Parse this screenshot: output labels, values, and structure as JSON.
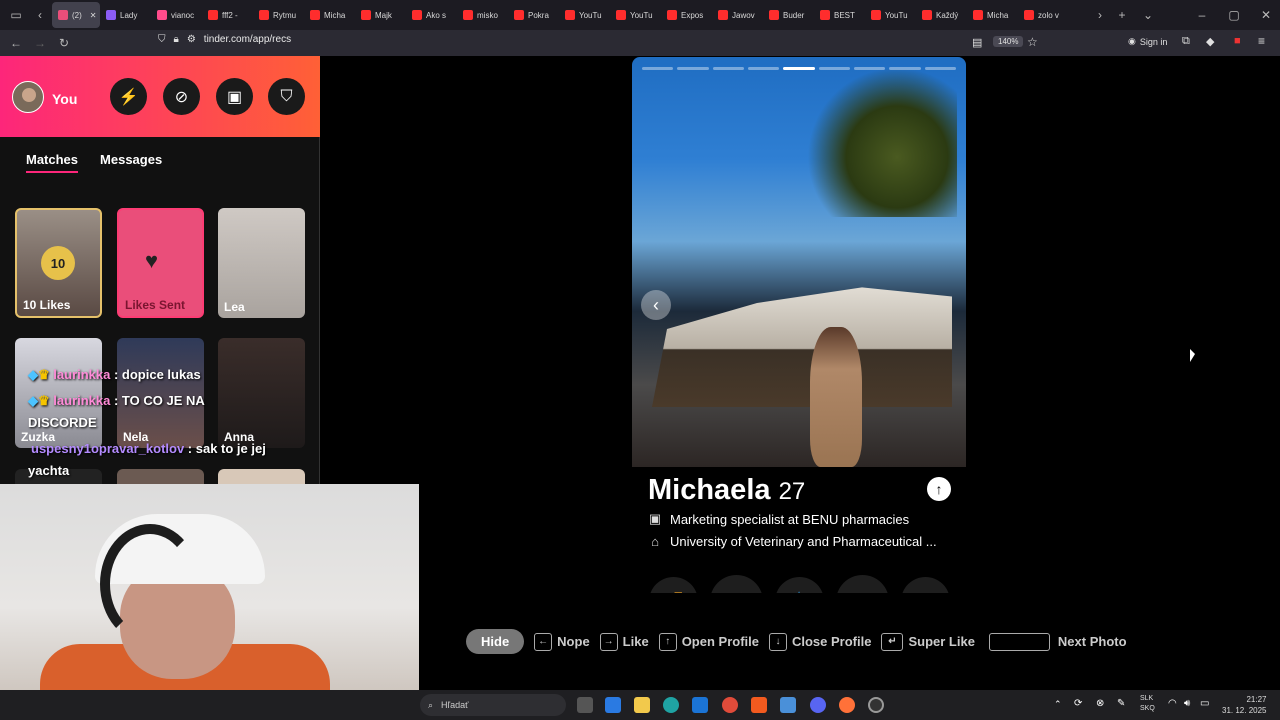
{
  "browser": {
    "tabs": [
      {
        "label": "(2)",
        "color": "#ea4e7a"
      },
      {
        "label": "Lady",
        "color": "#8b5cf6"
      },
      {
        "label": "vianoc",
        "color": "#ff4b8b"
      },
      {
        "label": "fff2 -",
        "color": "#ff2d2d"
      },
      {
        "label": "Rytmu",
        "color": "#ff2d2d"
      },
      {
        "label": "Micha",
        "color": "#ff2d2d"
      },
      {
        "label": "Majk",
        "color": "#ff2d2d"
      },
      {
        "label": "Ako s",
        "color": "#ff2d2d"
      },
      {
        "label": "misko",
        "color": "#ff2d2d"
      },
      {
        "label": "Pokra",
        "color": "#ff2d2d"
      },
      {
        "label": "YouTu",
        "color": "#ff2d2d"
      },
      {
        "label": "YouTu",
        "color": "#ff2d2d"
      },
      {
        "label": "Expos",
        "color": "#ff2d2d"
      },
      {
        "label": "Jawov",
        "color": "#ff2d2d"
      },
      {
        "label": "Buder",
        "color": "#ff2d2d"
      },
      {
        "label": "BEST",
        "color": "#ff2d2d"
      },
      {
        "label": "YouTu",
        "color": "#ff2d2d"
      },
      {
        "label": "Každý",
        "color": "#ff2d2d"
      },
      {
        "label": "Micha",
        "color": "#ff2d2d"
      },
      {
        "label": "zolo v",
        "color": "#ff2d2d"
      }
    ],
    "url": "tinder.com/app/recs",
    "zoom": "140%",
    "signin": "Sign in"
  },
  "left": {
    "you": "You",
    "tabs": {
      "matches": "Matches",
      "messages": "Messages"
    },
    "likes_count": "10",
    "likes_label": "10 Likes",
    "likes_sent": "Likes Sent",
    "cards": {
      "lea": "Lea",
      "zuzka": "Zuzka",
      "nela": "Nela",
      "anna": "Anna"
    }
  },
  "overlay": {
    "chat1_user": "laurinkka",
    "chat1_text": " : dopice lukas",
    "chat2_user": "laurinkka",
    "chat2_text": " : TO CO JE NA",
    "discorde": "DISCORDE",
    "chat3_user": "uspesny1opravar_kotlov",
    "chat3_text": " : sak to je jej",
    "yachta": "yachta"
  },
  "profile": {
    "name": "Michaela",
    "age": "27",
    "job": "Marketing specialist at BENU pharmacies",
    "school": "University of Veterinary and Pharmaceutical ...",
    "photo_count": 9,
    "photo_index": 5
  },
  "shortcuts": {
    "hide": "Hide",
    "nope": "Nope",
    "like": "Like",
    "open": "Open Profile",
    "close": "Close Profile",
    "super": "Super Like",
    "next": "Next Photo"
  },
  "taskbar": {
    "search": "Hľadať",
    "lang1": "SLK",
    "lang2": "SKQ",
    "time": "21:27",
    "date": "31. 12. 2025"
  },
  "colors": {
    "brand_start": "#fd267a",
    "brand_end": "#ff6036",
    "nope": "#fd3c74",
    "like": "#6ee61d",
    "super": "#2da8f5",
    "rewind": "#f5a623",
    "boost": "#1ea7f5"
  }
}
